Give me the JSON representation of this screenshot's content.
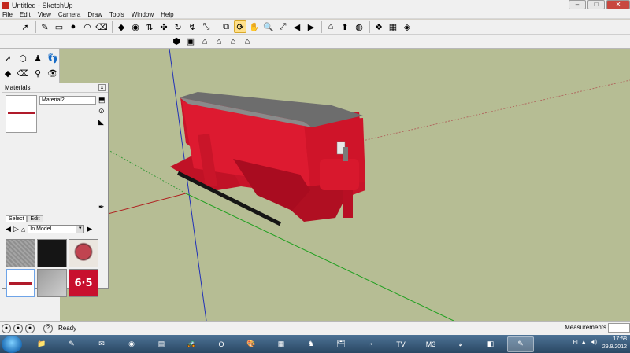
{
  "window": {
    "title": "Untitled - SketchUp",
    "minimize": "–",
    "maximize": "□",
    "close": "✕"
  },
  "menu": [
    "File",
    "Edit",
    "View",
    "Camera",
    "Draw",
    "Tools",
    "Window",
    "Help"
  ],
  "toolbar1": [
    {
      "name": "select-icon",
      "glyph": "➚"
    },
    {
      "name": "pencil-icon",
      "glyph": "✎"
    },
    {
      "name": "rectangle-icon",
      "glyph": "▭"
    },
    {
      "name": "circle-icon",
      "glyph": "●"
    },
    {
      "name": "arc-icon",
      "glyph": "◠"
    },
    {
      "name": "eraser-icon",
      "glyph": "⌫"
    },
    {
      "name": "paint-bucket-icon",
      "glyph": "◆"
    },
    {
      "name": "tape-measure-icon",
      "glyph": "◉"
    },
    {
      "name": "push-pull-icon",
      "glyph": "⇅"
    },
    {
      "name": "move-icon",
      "glyph": "✣"
    },
    {
      "name": "rotate-icon",
      "glyph": "↻"
    },
    {
      "name": "follow-me-icon",
      "glyph": "↯"
    },
    {
      "name": "scale-icon",
      "glyph": "⤡"
    },
    {
      "name": "offset-icon",
      "glyph": "⧉"
    },
    {
      "name": "orbit-icon",
      "glyph": "⟳"
    },
    {
      "name": "pan-icon",
      "glyph": "✋"
    },
    {
      "name": "zoom-icon",
      "glyph": "🔍"
    },
    {
      "name": "zoom-extents-icon",
      "glyph": "⤢"
    },
    {
      "name": "previous-view-icon",
      "glyph": "◀"
    },
    {
      "name": "next-view-icon",
      "glyph": "▶"
    },
    {
      "name": "get-models-icon",
      "glyph": "⌂"
    },
    {
      "name": "share-model-icon",
      "glyph": "⬆"
    },
    {
      "name": "google-earth-icon",
      "glyph": "◍"
    },
    {
      "name": "components-icon",
      "glyph": "❖"
    },
    {
      "name": "materials-icon",
      "glyph": "▦"
    },
    {
      "name": "styles-icon",
      "glyph": "◈"
    }
  ],
  "toolbar2": [
    {
      "name": "iso-view-icon",
      "glyph": "⬢"
    },
    {
      "name": "top-view-icon",
      "glyph": "▣"
    },
    {
      "name": "front-view-icon",
      "glyph": "⌂"
    },
    {
      "name": "right-view-icon",
      "glyph": "⌂"
    },
    {
      "name": "back-view-icon",
      "glyph": "⌂"
    },
    {
      "name": "left-view-icon",
      "glyph": "⌂"
    }
  ],
  "left_tools": [
    {
      "name": "select-tool-icon",
      "glyph": "➚"
    },
    {
      "name": "make-component-icon",
      "glyph": "⬡"
    },
    {
      "name": "walk-icon",
      "glyph": "♟"
    },
    {
      "name": "footprints-icon",
      "glyph": "👣"
    },
    {
      "name": "paint-tool-icon",
      "glyph": "◆"
    },
    {
      "name": "eraser-tool-icon",
      "glyph": "⌫"
    },
    {
      "name": "position-camera-icon",
      "glyph": "⚲"
    },
    {
      "name": "look-around-icon",
      "glyph": "👁"
    }
  ],
  "materials_panel": {
    "title": "Materials",
    "close": "x",
    "material_name": "Material2",
    "tabs": [
      "Select",
      "Edit"
    ],
    "collection": "In Model",
    "swatches": [
      {
        "name": "swatch-gray-texture",
        "label": ""
      },
      {
        "name": "swatch-black",
        "label": ""
      },
      {
        "name": "swatch-gauge",
        "label": ""
      },
      {
        "name": "swatch-material2",
        "label": ""
      },
      {
        "name": "swatch-gray-metal",
        "label": ""
      },
      {
        "name": "swatch-65-decal",
        "label": "6·5"
      }
    ]
  },
  "status": {
    "text": "Ready",
    "measurements_label": "Measurements"
  },
  "taskbar": {
    "apps": [
      {
        "name": "explorer-icon",
        "glyph": "📁"
      },
      {
        "name": "sketchup-task-icon",
        "glyph": "✎"
      },
      {
        "name": "mail-icon",
        "glyph": "✉"
      },
      {
        "name": "blender-icon",
        "glyph": "◉"
      },
      {
        "name": "editor-icon",
        "glyph": "▤"
      },
      {
        "name": "tractor-icon",
        "glyph": "🚜"
      },
      {
        "name": "opera-icon",
        "glyph": "O"
      },
      {
        "name": "paint-icon",
        "glyph": "🎨"
      },
      {
        "name": "calculator-icon",
        "glyph": "▦"
      },
      {
        "name": "game-icon",
        "glyph": "♞"
      },
      {
        "name": "folder-icon",
        "glyph": "🗂"
      },
      {
        "name": "media-icon",
        "glyph": "◔"
      },
      {
        "name": "tv-icon",
        "glyph": "TV"
      },
      {
        "name": "bmw-icon",
        "glyph": "M3"
      },
      {
        "name": "chrome-icon",
        "glyph": "◕"
      },
      {
        "name": "archive-icon",
        "glyph": "◧"
      },
      {
        "name": "sketchup-active-icon",
        "glyph": "✎"
      }
    ],
    "tray": "FI",
    "time": "17:58",
    "date": "29.9.2012"
  },
  "colors": {
    "model_red": "#d3162a",
    "viewport_bg": "#b6bd94"
  }
}
